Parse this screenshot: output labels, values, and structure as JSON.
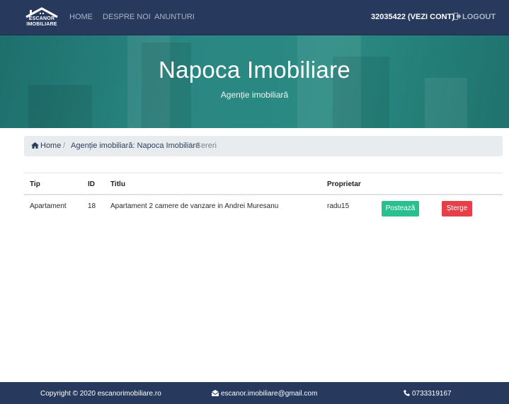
{
  "navbar": {
    "logo_text_line1": "ESCANOR",
    "logo_text_line2": "IMOBILIARE",
    "links": [
      "HOME",
      "DESPRE NOI",
      "ANUNTURI"
    ],
    "account": "32035422 (VEZI CONT)",
    "logout": "LOGOUT"
  },
  "hero": {
    "title": "Napoca Imobiliare",
    "subtitle": "Agenție imobiliară"
  },
  "breadcrumb": {
    "home": "Home",
    "agency": "Agenție imobiliară: Napoca Imobiliare",
    "current": "Cereri"
  },
  "table": {
    "headers": [
      "Tip",
      "ID",
      "Titlu",
      "Proprietar"
    ],
    "rows": [
      {
        "tip": "Apartament",
        "id": "18",
        "titlu": "Apartament 2 camere de vanzare in Andrei Muresanu",
        "proprietar": "radu15",
        "post_label": "Postează",
        "delete_label": "Șterge"
      }
    ]
  },
  "footer": {
    "copyright": "Copyright © 2020 escanorimobiliare.ro",
    "email": "escanor.imobiliare@gmail.com",
    "phone": "0733319167"
  },
  "colors": {
    "navbar": "#273a5e",
    "hero": "#2a8682",
    "post_button": "#27c08e",
    "delete_button": "#e5404a"
  }
}
